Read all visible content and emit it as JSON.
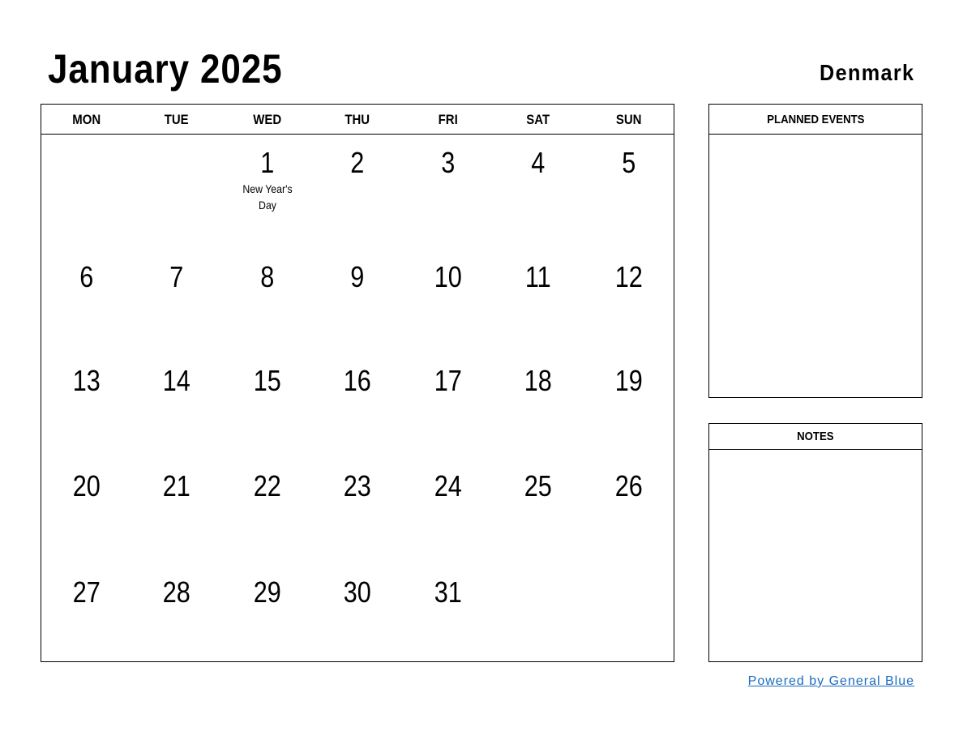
{
  "header": {
    "title": "January 2025",
    "country": "Denmark"
  },
  "calendar": {
    "weekdays": [
      "MON",
      "TUE",
      "WED",
      "THU",
      "FRI",
      "SAT",
      "SUN"
    ],
    "weeks": [
      [
        {
          "day": ""
        },
        {
          "day": ""
        },
        {
          "day": "1",
          "holiday": "New Year's Day"
        },
        {
          "day": "2"
        },
        {
          "day": "3"
        },
        {
          "day": "4"
        },
        {
          "day": "5"
        }
      ],
      [
        {
          "day": "6"
        },
        {
          "day": "7"
        },
        {
          "day": "8"
        },
        {
          "day": "9"
        },
        {
          "day": "10"
        },
        {
          "day": "11"
        },
        {
          "day": "12"
        }
      ],
      [
        {
          "day": "13"
        },
        {
          "day": "14"
        },
        {
          "day": "15"
        },
        {
          "day": "16"
        },
        {
          "day": "17"
        },
        {
          "day": "18"
        },
        {
          "day": "19"
        }
      ],
      [
        {
          "day": "20"
        },
        {
          "day": "21"
        },
        {
          "day": "22"
        },
        {
          "day": "23"
        },
        {
          "day": "24"
        },
        {
          "day": "25"
        },
        {
          "day": "26"
        }
      ],
      [
        {
          "day": "27"
        },
        {
          "day": "28"
        },
        {
          "day": "29"
        },
        {
          "day": "30"
        },
        {
          "day": "31"
        },
        {
          "day": ""
        },
        {
          "day": ""
        }
      ]
    ]
  },
  "panels": {
    "planned_events": {
      "title": "PLANNED EVENTS"
    },
    "notes": {
      "title": "NOTES"
    }
  },
  "footer": {
    "link_text": "Powered by General Blue",
    "link_color": "#1a6bbf"
  }
}
